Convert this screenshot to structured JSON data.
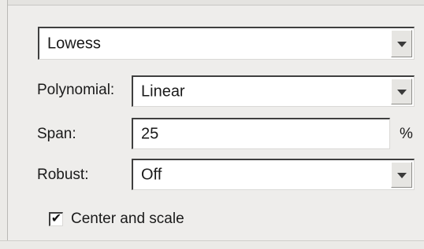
{
  "method": {
    "value": "Lowess"
  },
  "polynomial": {
    "label": "Polynomial:",
    "value": "Linear"
  },
  "span": {
    "label": "Span:",
    "value": "25",
    "unit": "%"
  },
  "robust": {
    "label": "Robust:",
    "value": "Off"
  },
  "center_scale": {
    "label": "Center and scale",
    "checked": true,
    "check_glyph": "✔"
  }
}
